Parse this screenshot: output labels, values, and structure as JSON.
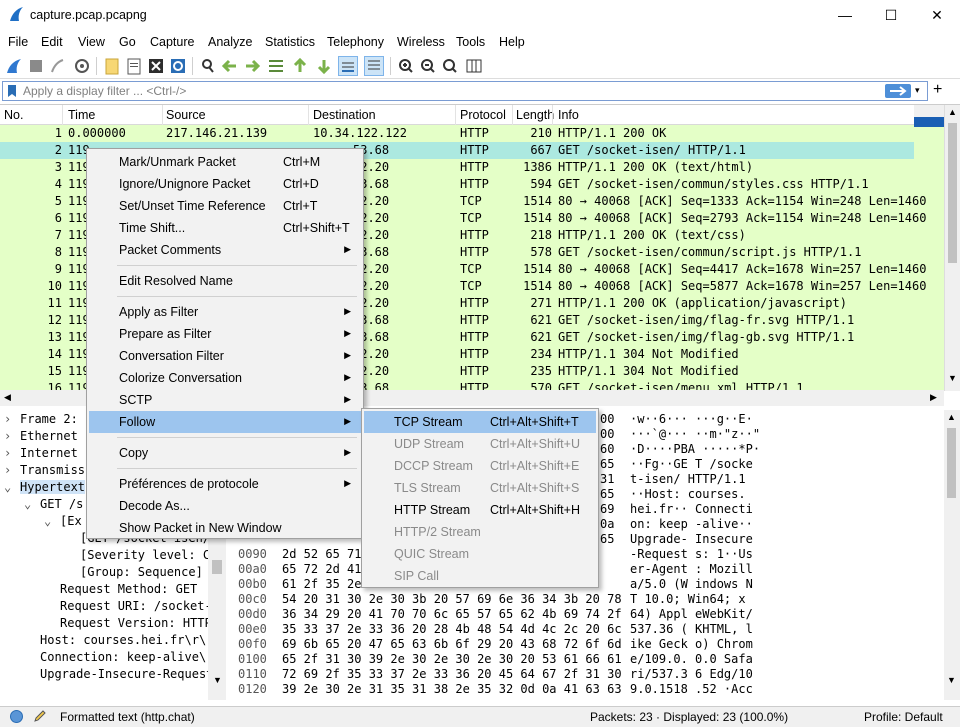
{
  "window": {
    "title": "capture.pcap.pcapng"
  },
  "menu": [
    "File",
    "Edit",
    "View",
    "Go",
    "Capture",
    "Analyze",
    "Statistics",
    "Telephony",
    "Wireless",
    "Tools",
    "Help"
  ],
  "filter": {
    "placeholder": "Apply a display filter ... <Ctrl-/>"
  },
  "columns": [
    "No.",
    "Time",
    "Source",
    "Destination",
    "Protocol",
    "Length",
    "Info"
  ],
  "packets": [
    {
      "no": "1",
      "time": "0.000000",
      "src": "217.146.21.139",
      "dst": "10.34.122.122",
      "proto": "HTTP",
      "len": "210",
      "info": "HTTP/1.1 200 OK"
    },
    {
      "no": "2",
      "time": "119",
      "src": "",
      "dst": "53.68",
      "proto": "HTTP",
      "len": "667",
      "info": "GET /socket-isen/ HTTP/1.1"
    },
    {
      "no": "3",
      "time": "119",
      "src": "",
      "dst": "22.20",
      "proto": "HTTP",
      "len": "1386",
      "info": "HTTP/1.1 200 OK  (text/html)"
    },
    {
      "no": "4",
      "time": "119",
      "src": "",
      "dst": "53.68",
      "proto": "HTTP",
      "len": "594",
      "info": "GET /socket-isen/commun/styles.css HTTP/1.1"
    },
    {
      "no": "5",
      "time": "119",
      "src": "",
      "dst": "22.20",
      "proto": "TCP",
      "len": "1514",
      "info": "80 → 40068 [ACK] Seq=1333 Ack=1154 Win=248 Len=1460"
    },
    {
      "no": "6",
      "time": "119",
      "src": "",
      "dst": "22.20",
      "proto": "TCP",
      "len": "1514",
      "info": "80 → 40068 [ACK] Seq=2793 Ack=1154 Win=248 Len=1460"
    },
    {
      "no": "7",
      "time": "119",
      "src": "",
      "dst": "22.20",
      "proto": "HTTP",
      "len": "218",
      "info": "HTTP/1.1 200 OK  (text/css)"
    },
    {
      "no": "8",
      "time": "119",
      "src": "",
      "dst": "53.68",
      "proto": "HTTP",
      "len": "578",
      "info": "GET /socket-isen/commun/script.js HTTP/1.1"
    },
    {
      "no": "9",
      "time": "119",
      "src": "",
      "dst": "22.20",
      "proto": "TCP",
      "len": "1514",
      "info": "80 → 40068 [ACK] Seq=4417 Ack=1678 Win=257 Len=1460"
    },
    {
      "no": "10",
      "time": "119",
      "src": "",
      "dst": "22.20",
      "proto": "TCP",
      "len": "1514",
      "info": "80 → 40068 [ACK] Seq=5877 Ack=1678 Win=257 Len=1460"
    },
    {
      "no": "11",
      "time": "119",
      "src": "",
      "dst": "22.20",
      "proto": "HTTP",
      "len": "271",
      "info": "HTTP/1.1 200 OK  (application/javascript)"
    },
    {
      "no": "12",
      "time": "119",
      "src": "",
      "dst": "53.68",
      "proto": "HTTP",
      "len": "621",
      "info": "GET /socket-isen/img/flag-fr.svg HTTP/1.1"
    },
    {
      "no": "13",
      "time": "119",
      "src": "",
      "dst": "53.68",
      "proto": "HTTP",
      "len": "621",
      "info": "GET /socket-isen/img/flag-gb.svg HTTP/1.1"
    },
    {
      "no": "14",
      "time": "119",
      "src": "",
      "dst": "22.20",
      "proto": "HTTP",
      "len": "234",
      "info": "HTTP/1.1 304 Not Modified"
    },
    {
      "no": "15",
      "time": "119",
      "src": "",
      "dst": "22.20",
      "proto": "HTTP",
      "len": "235",
      "info": "HTTP/1.1 304 Not Modified"
    },
    {
      "no": "16",
      "time": "119",
      "src": "",
      "dst": "53.68",
      "proto": "HTTP",
      "len": "570",
      "info": "GET /socket-isen/menu.xml HTTP/1.1"
    }
  ],
  "details": [
    {
      "text": "Frame 2:",
      "exp": "›"
    },
    {
      "text": "Ethernet",
      "exp": "›"
    },
    {
      "text": "Internet",
      "exp": "›"
    },
    {
      "text": "Transmiss",
      "exp": "›"
    },
    {
      "text": "Hypertext",
      "exp": "⌄"
    },
    {
      "text": "GET /s",
      "exp": "⌄"
    },
    {
      "text": "[Ex",
      "exp": "⌄"
    },
    {
      "text": "[GET /socket-isen/",
      "exp": ""
    },
    {
      "text": "[Severity level: C",
      "exp": ""
    },
    {
      "text": "[Group: Sequence]",
      "exp": ""
    },
    {
      "text": "Request Method: GET",
      "exp": ""
    },
    {
      "text": "Request URI: /socket-",
      "exp": ""
    },
    {
      "text": "Request Version: HTTP",
      "exp": ""
    },
    {
      "text": "Host: courses.hei.fr\\r\\",
      "exp": ""
    },
    {
      "text": "Connection: keep-alive\\",
      "exp": ""
    },
    {
      "text": "Upgrade-Insecure-Request",
      "exp": ""
    }
  ],
  "bytes": [
    {
      "off": "",
      "hex": "00",
      "ascii": "·w··6···  ···g··E·"
    },
    {
      "off": "",
      "hex": "00",
      "ascii": "···`@···  ··m·\"z··\""
    },
    {
      "off": "",
      "hex": "60",
      "ascii": "·D····PBA  ·····*P·"
    },
    {
      "off": "",
      "hex": "65",
      "ascii": "··Fg··GE  T /socke"
    },
    {
      "off": "",
      "hex": "31",
      "ascii": "t-isen/  HTTP/1.1"
    },
    {
      "off": "",
      "hex": "65",
      "ascii": "··Host:  courses."
    },
    {
      "off": "",
      "hex": "69",
      "ascii": "hei.fr··  Connecti"
    },
    {
      "off": "",
      "hex": "0a",
      "ascii": "on: keep  -alive··"
    },
    {
      "off": "",
      "hex": "65",
      "ascii": "Upgrade-  Insecure"
    },
    {
      "off": "0090",
      "hex": "2d 52 65 71",
      "ascii": "-Request  s: 1··Us"
    },
    {
      "off": "00a0",
      "hex": "65 72 2d 41",
      "ascii": "er-Agent  : Mozill"
    },
    {
      "off": "00b0",
      "hex": "61 2f 35 2e",
      "ascii": "a/5.0 (W  indows N"
    },
    {
      "off": "00c0",
      "hex": "54 20 31 30 2e 30 3b 20  57 69 6e 36 34 3b 20 78",
      "ascii": "T 10.0;  Win64; x"
    },
    {
      "off": "00d0",
      "hex": "36 34 29 20 41 70 70 6c  65 57 65 62 4b 69 74 2f",
      "ascii": "64) Appl  eWebKit/"
    },
    {
      "off": "00e0",
      "hex": "35 33 37 2e 33 36 20 28  4b 48 54 4d 4c 2c 20 6c",
      "ascii": "537.36 (  KHTML, l"
    },
    {
      "off": "00f0",
      "hex": "69 6b 65 20 47 65 63 6b  6f 29 20 43 68 72 6f 6d",
      "ascii": "ike Geck  o) Chrom"
    },
    {
      "off": "0100",
      "hex": "65 2f 31 30 39 2e 30 2e  30 2e 30 20 53 61 66 61",
      "ascii": "e/109.0.  0.0 Safa"
    },
    {
      "off": "0110",
      "hex": "72 69 2f 35 33 37 2e 33  36 20 45 64 67 2f 31 30",
      "ascii": "ri/537.3  6 Edg/10"
    },
    {
      "off": "0120",
      "hex": "39 2e 30 2e 31 35 31 38  2e 35 32 0d 0a 41 63 63",
      "ascii": "9.0.1518  .52 ·Acc"
    }
  ],
  "context_menu": [
    {
      "label": "Mark/Unmark Packet",
      "shortcut": "Ctrl+M",
      "arrow": false
    },
    {
      "label": "Ignore/Unignore Packet",
      "shortcut": "Ctrl+D",
      "arrow": false
    },
    {
      "label": "Set/Unset Time Reference",
      "shortcut": "Ctrl+T",
      "arrow": false
    },
    {
      "label": "Time Shift...",
      "shortcut": "Ctrl+Shift+T",
      "arrow": false
    },
    {
      "label": "Packet Comments",
      "shortcut": "",
      "arrow": true
    },
    {
      "sep": true
    },
    {
      "label": "Edit Resolved Name",
      "shortcut": "",
      "arrow": false
    },
    {
      "sep": true
    },
    {
      "label": "Apply as Filter",
      "shortcut": "",
      "arrow": true
    },
    {
      "label": "Prepare as Filter",
      "shortcut": "",
      "arrow": true
    },
    {
      "label": "Conversation Filter",
      "shortcut": "",
      "arrow": true
    },
    {
      "label": "Colorize Conversation",
      "shortcut": "",
      "arrow": true
    },
    {
      "label": "SCTP",
      "shortcut": "",
      "arrow": true
    },
    {
      "label": "Follow",
      "shortcut": "",
      "arrow": true,
      "highlight": true
    },
    {
      "sep": true
    },
    {
      "label": "Copy",
      "shortcut": "",
      "arrow": true
    },
    {
      "sep": true
    },
    {
      "label": "Préférences de protocole",
      "shortcut": "",
      "arrow": true
    },
    {
      "label": "Decode As...",
      "shortcut": "",
      "arrow": false
    },
    {
      "label": "Show Packet in New Window",
      "shortcut": "",
      "arrow": false
    }
  ],
  "submenu": [
    {
      "label": "TCP Stream",
      "shortcut": "Ctrl+Alt+Shift+T",
      "enabled": true,
      "highlight": true
    },
    {
      "label": "UDP Stream",
      "shortcut": "Ctrl+Alt+Shift+U",
      "enabled": false
    },
    {
      "label": "DCCP Stream",
      "shortcut": "Ctrl+Alt+Shift+E",
      "enabled": false
    },
    {
      "label": "TLS Stream",
      "shortcut": "Ctrl+Alt+Shift+S",
      "enabled": false
    },
    {
      "label": "HTTP Stream",
      "shortcut": "Ctrl+Alt+Shift+H",
      "enabled": true
    },
    {
      "label": "HTTP/2 Stream",
      "shortcut": "",
      "enabled": false
    },
    {
      "label": "QUIC Stream",
      "shortcut": "",
      "enabled": false
    },
    {
      "label": "SIP Call",
      "shortcut": "",
      "enabled": false
    }
  ],
  "status": {
    "text": "Formatted text (http.chat)",
    "packets": "Packets: 23 · Displayed: 23 (100.0%)",
    "profile": "Profile: Default"
  },
  "colors": {
    "http_row": "#e4ffc7",
    "selected_row": "#ace9e0",
    "menu_highlight": "#9dc5ee",
    "detail_selected": "#cfe3f7"
  }
}
